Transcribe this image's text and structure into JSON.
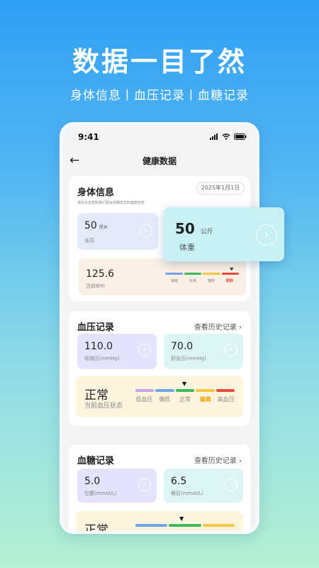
{
  "banner": {
    "headline": "数据一目了然",
    "subline": "身体信息丨血压记录丨血糖记录"
  },
  "status_bar": {
    "time": "9:41"
  },
  "nav": {
    "back_icon": "arrow-left-icon",
    "title": "健康数据"
  },
  "body_info": {
    "title": "身体信息",
    "hint": "填写信息帮助我们更好的确定您的健康状态",
    "date": "2025年1月1日",
    "height": {
      "value": "50",
      "unit": "厘米",
      "label": "身高"
    },
    "weight_hidden_label": "体重",
    "bmi": {
      "value": "125.6",
      "label": "当前BMI",
      "scale_labels": [
        "偏瘦",
        "标准",
        "偏胖",
        "肥胖"
      ],
      "scale_colors": [
        "#6fa6e8",
        "#3dbb5a",
        "#f4c64a",
        "#e84a3f"
      ],
      "highlight_color": "#e84a3f"
    }
  },
  "weight_popup": {
    "value": "50",
    "unit": "公斤",
    "label": "体重"
  },
  "blood_pressure": {
    "title": "血压记录",
    "history_link": "查看历史记录",
    "systolic": {
      "value": "110.0",
      "label": "收缩压(mmHg)"
    },
    "diastolic": {
      "value": "70.0",
      "label": "舒张压(mmHg)"
    },
    "status": {
      "value": "正常",
      "label": "当前血压状态",
      "scale_labels": [
        "低血压",
        "偏低",
        "正常",
        "偏高",
        "高血压"
      ],
      "scale_colors": [
        "#c8a2e8",
        "#6fa6e8",
        "#3dbb5a",
        "#f4c64a",
        "#e84a3f"
      ],
      "highlight_color": "#f0a500"
    }
  },
  "blood_sugar": {
    "title": "血糖记录",
    "history_link": "查看历史记录",
    "fasting": {
      "value": "5.0",
      "label": "空腹(mmol/L)"
    },
    "postmeal": {
      "value": "6.5",
      "label": "餐后(mmol/L)"
    },
    "status": {
      "value": "正常",
      "scale_colors": [
        "#6fa6e8",
        "#3dbb5a",
        "#f4c64a"
      ]
    }
  },
  "colors": {
    "accent_blue": "#2f9ff5",
    "tile_purple": "#e3e3fb",
    "tile_teal": "#dcf5f4",
    "tile_blue": "#e3ebfb",
    "popup_cyan": "#c8f1f6"
  }
}
